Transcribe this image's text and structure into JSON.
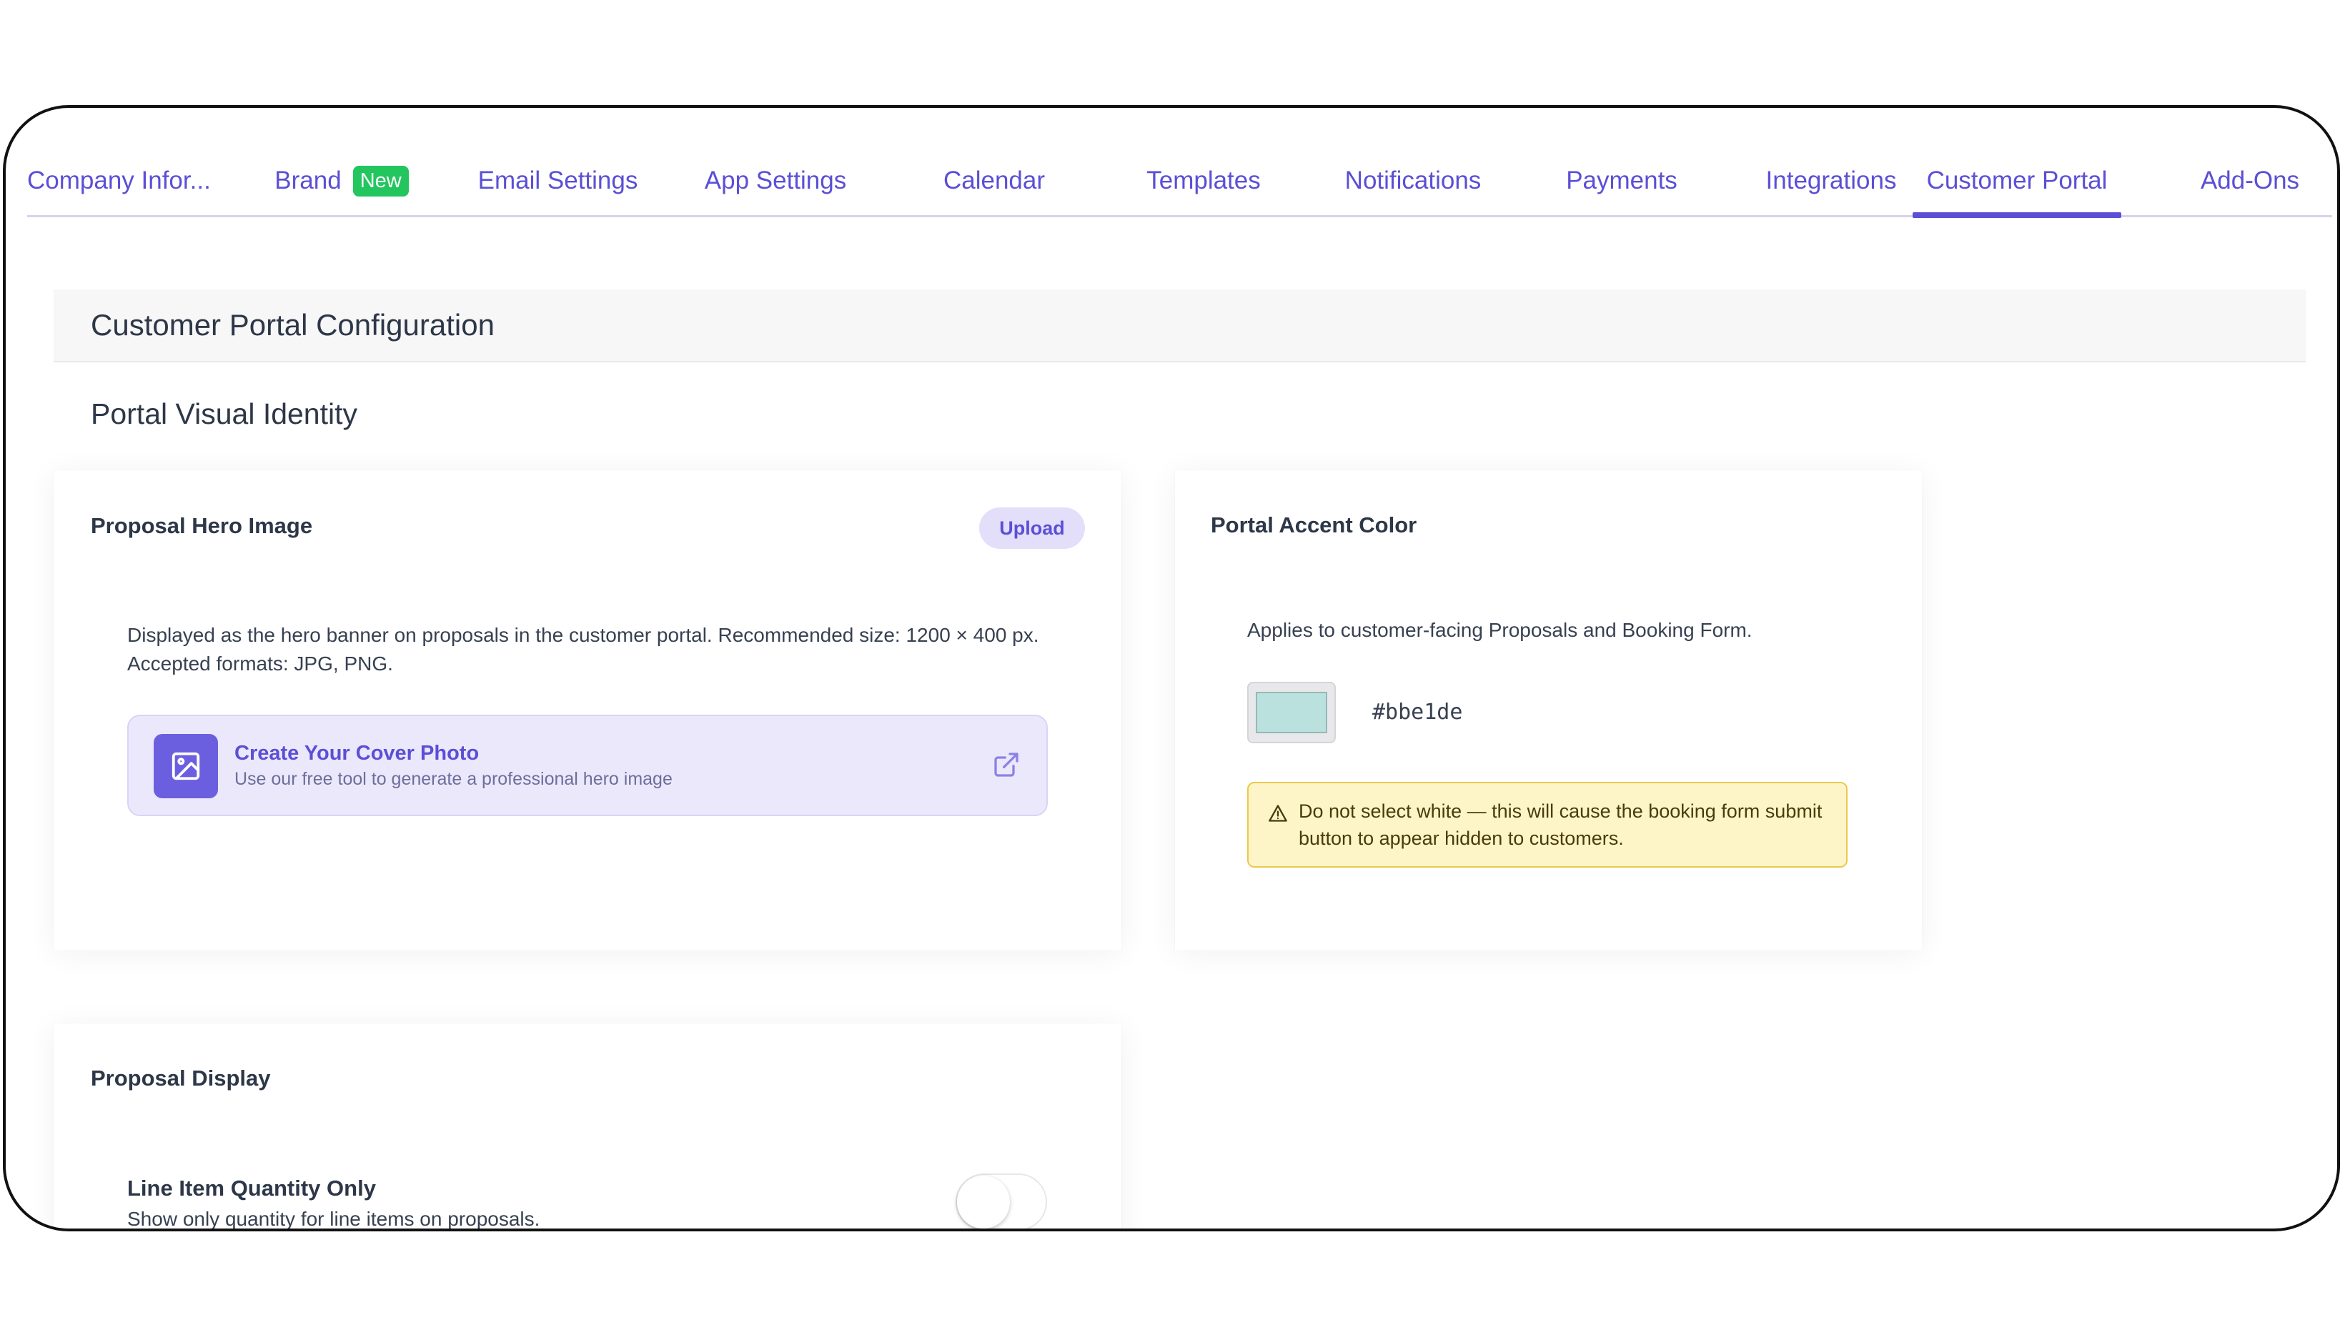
{
  "tabs": [
    {
      "label": "Company Infor..."
    },
    {
      "label": "Brand",
      "badge": "New"
    },
    {
      "label": "Email Settings"
    },
    {
      "label": "App Settings"
    },
    {
      "label": "Calendar"
    },
    {
      "label": "Templates"
    },
    {
      "label": "Notifications"
    },
    {
      "label": "Payments"
    },
    {
      "label": "Integrations"
    },
    {
      "label": "Customer Portal",
      "active": true
    },
    {
      "label": "Add-Ons"
    }
  ],
  "config": {
    "title": "Customer Portal Configuration"
  },
  "visual_identity": {
    "title": "Portal Visual Identity"
  },
  "hero_card": {
    "title": "Proposal Hero Image",
    "upload_label": "Upload",
    "description": "Displayed as the hero banner on proposals in the customer portal. Recommended size: 1200 × 400 px. Accepted formats: JPG, PNG.",
    "cover": {
      "title": "Create Your Cover Photo",
      "subtitle": "Use our free tool to generate a professional hero image",
      "icon": "image-icon",
      "link_icon": "external-link-icon"
    }
  },
  "accent_card": {
    "title": "Portal Accent Color",
    "description": "Applies to customer-facing Proposals and Booking Form.",
    "color_hex": "#bbe1de",
    "warning": "Do not select white — this will cause the booking form submit button to appear hidden to customers.",
    "warning_icon": "warning-triangle-icon"
  },
  "display_card": {
    "title": "Proposal Display",
    "item_title": "Line Item Quantity Only",
    "item_description": "Show only quantity for line items on proposals.",
    "toggle_on": false
  },
  "colors": {
    "accent": "#5b4fd6",
    "badge_green": "#22c55e",
    "swatch": "#bbe1de",
    "warning_bg": "#fdf5c8"
  }
}
